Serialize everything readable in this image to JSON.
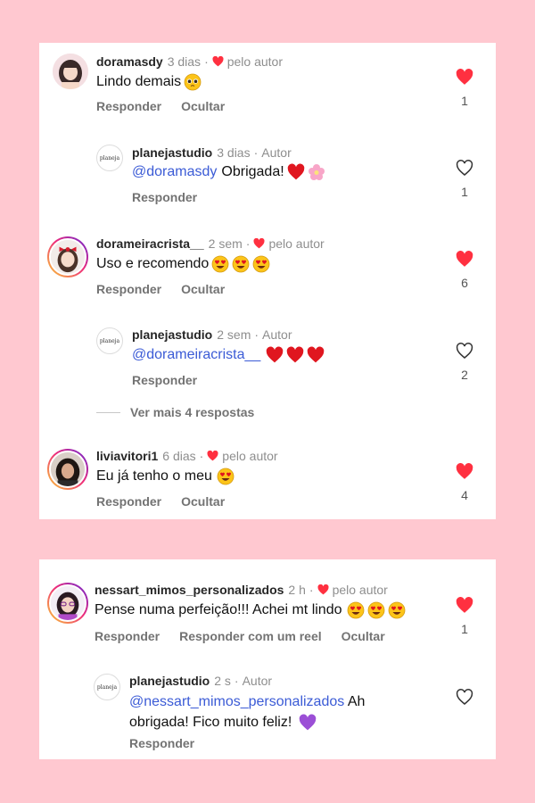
{
  "colors": {
    "background": "#ffc8d0",
    "liked_heart": "#ff3040",
    "mention": "#3b5bd6",
    "muted": "#8e8e8e"
  },
  "icons": {
    "liked": "heart-filled-icon",
    "unliked": "heart-outline-icon"
  },
  "card1": {
    "comments": [
      {
        "username": "doramasdy",
        "time": "3 dias",
        "by_author": "pelo autor",
        "text": "Lindo demais",
        "emojis": [
          "pleading-face"
        ],
        "reply_label": "Responder",
        "hide_label": "Ocultar",
        "like_count": "1",
        "liked": true
      },
      {
        "username": "planejastudio",
        "avatar_label": "planeja",
        "time": "3 dias",
        "author_label": "Autor",
        "mention": "@doramasdy",
        "text": "Obrigada!",
        "emojis": [
          "red-heart",
          "pink-flower"
        ],
        "reply_label": "Responder",
        "like_count": "1",
        "liked": false
      },
      {
        "username": "dorameiracrista__",
        "time": "2 sem",
        "by_author": "pelo autor",
        "text": "Uso e recomendo",
        "emojis": [
          "heart-eyes",
          "heart-eyes",
          "heart-eyes"
        ],
        "reply_label": "Responder",
        "hide_label": "Ocultar",
        "like_count": "6",
        "liked": true
      },
      {
        "username": "planejastudio",
        "avatar_label": "planeja",
        "time": "2 sem",
        "author_label": "Autor",
        "mention": "@dorameiracrista__",
        "emojis": [
          "red-heart",
          "red-heart",
          "red-heart"
        ],
        "reply_label": "Responder",
        "like_count": "2",
        "liked": false
      },
      {
        "username": "liviavitori1",
        "time": "6 dias",
        "by_author": "pelo autor",
        "text": "Eu já tenho o meu",
        "emojis": [
          "heart-eyes"
        ],
        "reply_label": "Responder",
        "hide_label": "Ocultar",
        "like_count": "4",
        "liked": true
      }
    ],
    "view_more": "Ver mais 4 respostas"
  },
  "card2": {
    "comments": [
      {
        "username": "nessart_mimos_personalizados",
        "time": "2 h",
        "by_author": "pelo autor",
        "text": "Pense numa perfeição!!! Achei mt lindo",
        "emojis": [
          "heart-eyes",
          "heart-eyes",
          "heart-eyes"
        ],
        "reply_label": "Responder",
        "reel_label": "Responder com um reel",
        "hide_label": "Ocultar",
        "like_count": "1",
        "liked": true
      },
      {
        "username": "planejastudio",
        "avatar_label": "planeja",
        "time": "2 s",
        "author_label": "Autor",
        "mention": "@nessart_mimos_personalizados",
        "text": "Ah obrigada! Fico muito feliz!",
        "emojis": [
          "purple-heart"
        ],
        "reply_label": "Responder",
        "liked": false
      }
    ]
  }
}
